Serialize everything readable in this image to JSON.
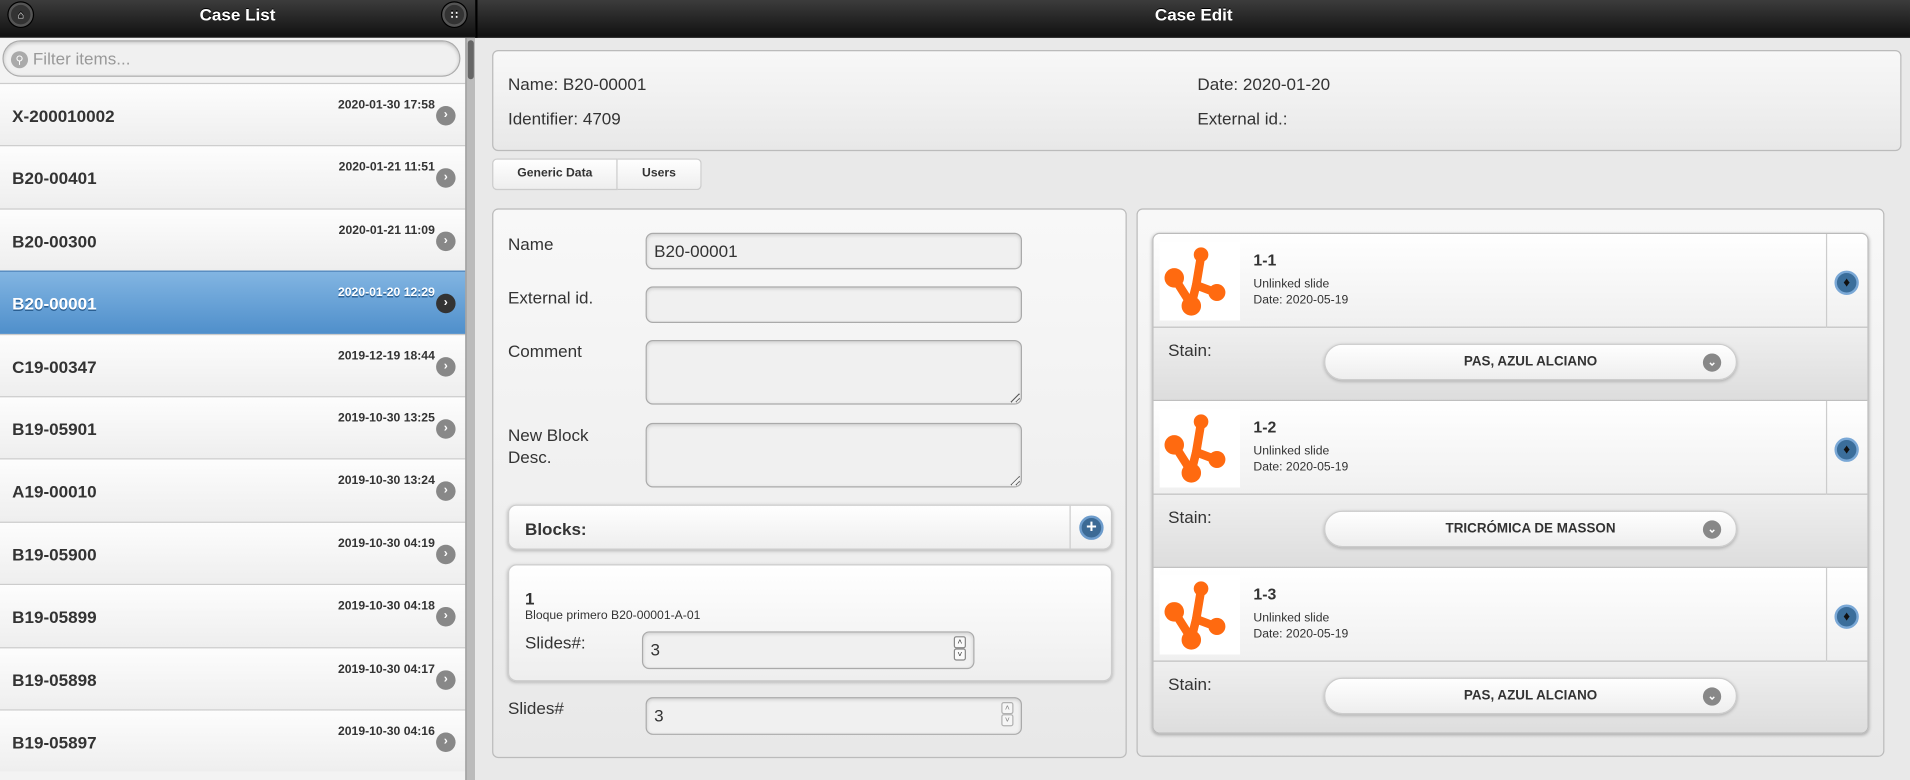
{
  "case_list": {
    "title": "Case List",
    "filter_placeholder": "Filter items...",
    "items": [
      {
        "name": "X-200010002",
        "date": "2020-01-30 17:58"
      },
      {
        "name": "B20-00401",
        "date": "2020-01-21 11:51"
      },
      {
        "name": "B20-00300",
        "date": "2020-01-21 11:09"
      },
      {
        "name": "B20-00001",
        "date": "2020-01-20 12:29",
        "selected": true
      },
      {
        "name": "C19-00347",
        "date": "2019-12-19 18:44"
      },
      {
        "name": "B19-05901",
        "date": "2019-10-30 13:25"
      },
      {
        "name": "A19-00010",
        "date": "2019-10-30 13:24"
      },
      {
        "name": "B19-05900",
        "date": "2019-10-30 04:19"
      },
      {
        "name": "B19-05899",
        "date": "2019-10-30 04:18"
      },
      {
        "name": "B19-05898",
        "date": "2019-10-30 04:17"
      },
      {
        "name": "B19-05897",
        "date": "2019-10-30 04:16"
      }
    ]
  },
  "case_edit": {
    "title": "Case Edit",
    "info": {
      "name": "Name: B20-00001",
      "date": "Date: 2020-01-20",
      "identifier": "Identifier: 4709",
      "external_id": "External id.:"
    },
    "tabs": [
      "Generic Data",
      "Users"
    ],
    "form": {
      "name_label": "Name",
      "name_value": "B20-00001",
      "external_label": "External id.",
      "external_value": "",
      "comment_label": "Comment",
      "comment_value": "",
      "newblock_label": "New Block Desc.",
      "newblock_value": "",
      "blocks_label": "Blocks:",
      "block": {
        "number": "1",
        "desc": "Bloque primero B20-00001-A-01",
        "slides_label": "Slides#:",
        "slides_value": "3"
      },
      "slides_label": "Slides#",
      "slides_value": "3"
    },
    "slides": [
      {
        "title": "1-1",
        "status": "Unlinked slide",
        "date": "Date: 2020-05-19",
        "stain_label": "Stain:",
        "stain": "PAS, AZUL ALCIANO"
      },
      {
        "title": "1-2",
        "status": "Unlinked slide",
        "date": "Date: 2020-05-19",
        "stain_label": "Stain:",
        "stain": "TRICRÓMICA DE MASSON"
      },
      {
        "title": "1-3",
        "status": "Unlinked slide",
        "date": "Date: 2020-05-19",
        "stain_label": "Stain:",
        "stain": "PAS, AZUL ALCIANO"
      }
    ],
    "colors": {
      "selected_row": "#5a9ad3",
      "accent_orange": "#ff6a10",
      "plus_button": "#3c6a95"
    }
  }
}
